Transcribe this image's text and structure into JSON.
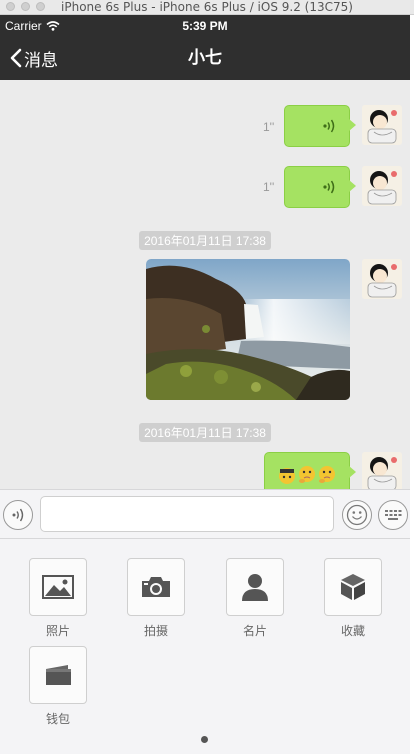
{
  "window": {
    "title": "iPhone 6s Plus - iPhone 6s Plus / iOS 9.2 (13C75)"
  },
  "statusbar": {
    "carrier": "Carrier",
    "time": "5:39 PM"
  },
  "navbar": {
    "back_label": "消息",
    "title": "小七"
  },
  "messages": {
    "voice1_duration": "1''",
    "voice2_duration": "1''",
    "timestamp1": "2016年01月11日 17:38",
    "timestamp2": "2016年01月11日 17:38"
  },
  "toolbar": {
    "photo_label": "照片",
    "camera_label": "拍摄",
    "card_label": "名片",
    "favorites_label": "收藏",
    "wallet_label": "钱包"
  },
  "colors": {
    "bubble": "#a5e262",
    "navbar": "#2f2f2f",
    "chat_bg": "#ebebeb"
  }
}
